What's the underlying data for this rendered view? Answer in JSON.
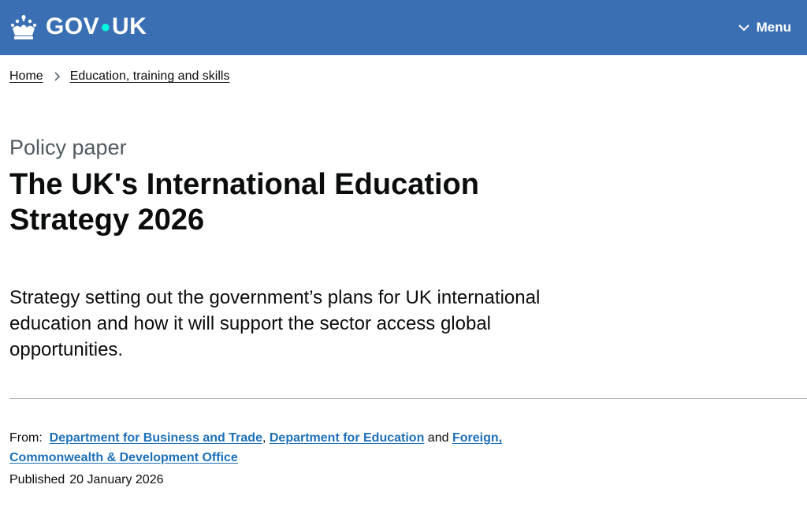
{
  "header": {
    "logo_text_left": "GOV",
    "logo_text_right": "UK",
    "menu_label": "Menu",
    "background_color": "#3a70b3"
  },
  "breadcrumb": {
    "items": [
      "Home",
      "Education, training and skills"
    ]
  },
  "page": {
    "caption": "Policy paper",
    "title": "The UK's International Education Strategy 2026",
    "lead": "Strategy setting out the government’s plans for UK international education and how it will support the sector access global opportunities."
  },
  "metadata": {
    "from_label": "From:",
    "organisations": [
      "Department for Business and Trade",
      "Department for Education",
      "Foreign, Commonwealth & Development Office"
    ],
    "separator_comma": ",",
    "separator_and": "and",
    "published_label": "Published",
    "published_date": "20 January 2026"
  },
  "icons": [
    "crown-icon",
    "chevron-down-icon",
    "chevron-right-icon"
  ]
}
